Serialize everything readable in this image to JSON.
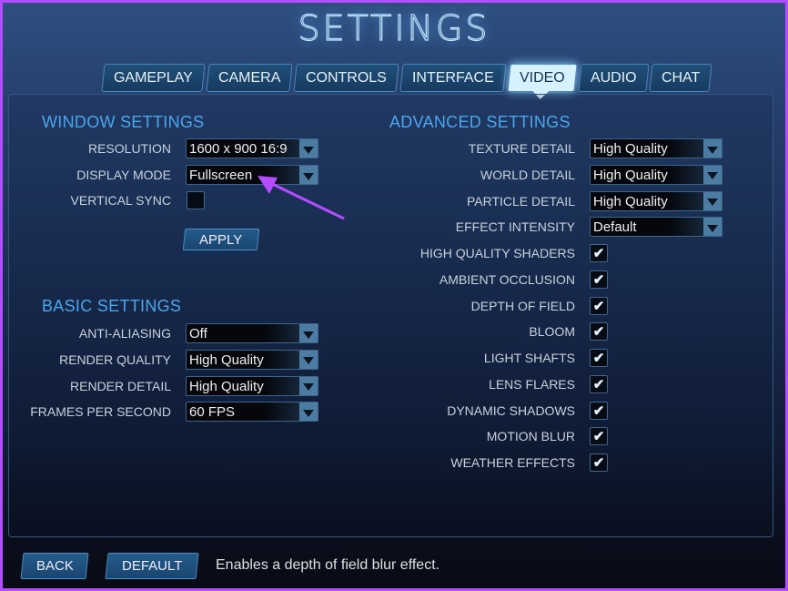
{
  "title": "SETTINGS",
  "tabs": [
    "GAMEPLAY",
    "CAMERA",
    "CONTROLS",
    "INTERFACE",
    "VIDEO",
    "AUDIO",
    "CHAT"
  ],
  "active_tab": "VIDEO",
  "window_settings": {
    "header": "WINDOW SETTINGS",
    "resolution": {
      "label": "RESOLUTION",
      "value": "1600 x 900 16:9"
    },
    "display_mode": {
      "label": "DISPLAY MODE",
      "value": "Fullscreen"
    },
    "vertical_sync": {
      "label": "VERTICAL SYNC",
      "checked": false
    },
    "apply": "APPLY"
  },
  "basic_settings": {
    "header": "BASIC SETTINGS",
    "rows": [
      {
        "label": "ANTI-ALIASING",
        "value": "Off"
      },
      {
        "label": "RENDER QUALITY",
        "value": "High Quality"
      },
      {
        "label": "RENDER DETAIL",
        "value": "High Quality"
      },
      {
        "label": "FRAMES PER SECOND",
        "value": "60  FPS"
      }
    ]
  },
  "advanced_settings": {
    "header": "ADVANCED SETTINGS",
    "dropdowns": [
      {
        "label": "TEXTURE DETAIL",
        "value": "High Quality"
      },
      {
        "label": "WORLD DETAIL",
        "value": "High Quality"
      },
      {
        "label": "PARTICLE DETAIL",
        "value": "High Quality"
      },
      {
        "label": "EFFECT INTENSITY",
        "value": "Default"
      }
    ],
    "checkboxes": [
      {
        "label": "HIGH QUALITY SHADERS",
        "checked": true
      },
      {
        "label": "AMBIENT OCCLUSION",
        "checked": true
      },
      {
        "label": "DEPTH OF FIELD",
        "checked": true
      },
      {
        "label": "BLOOM",
        "checked": true
      },
      {
        "label": "LIGHT SHAFTS",
        "checked": true
      },
      {
        "label": "LENS FLARES",
        "checked": true
      },
      {
        "label": "DYNAMIC SHADOWS",
        "checked": true
      },
      {
        "label": "MOTION BLUR",
        "checked": true
      },
      {
        "label": "WEATHER EFFECTS",
        "checked": true
      }
    ]
  },
  "footer": {
    "back": "BACK",
    "default": "DEFAULT",
    "description": "Enables a depth of field blur effect."
  },
  "colors": {
    "accent": "#4aa7ec",
    "annotation_arrow": "#b44cff",
    "border": "#b44cff"
  }
}
